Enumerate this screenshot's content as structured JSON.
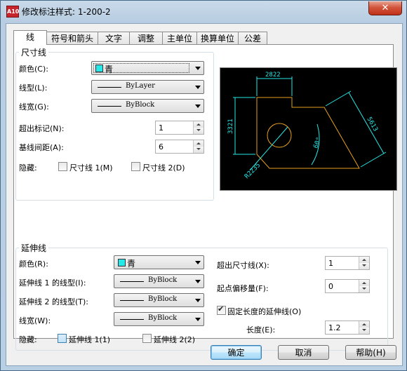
{
  "window": {
    "title": "修改标注样式: 1-200-2",
    "app_icon_text": "A10",
    "close_symbol": "✕"
  },
  "tabs": [
    "线",
    "符号和箭头",
    "文字",
    "调整",
    "主单位",
    "换算单位",
    "公差"
  ],
  "dim_line": {
    "group_title": "尺寸线",
    "color_label": "颜色(C):",
    "color_value": "青",
    "linetype_label": "线型(L):",
    "linetype_value": "ByLayer",
    "lineweight_label": "线宽(G):",
    "lineweight_value": "ByBlock",
    "extend_ticks_label": "超出标记(N):",
    "extend_ticks_value": "1",
    "baseline_spacing_label": "基线间距(A):",
    "baseline_spacing_value": "6",
    "suppress_label": "隐藏:",
    "suppress_1_label": "尺寸线 1(M)",
    "suppress_1_checked": false,
    "suppress_2_label": "尺寸线 2(D)",
    "suppress_2_checked": false
  },
  "preview": {
    "dim_top": "2822",
    "dim_left": "3321",
    "dim_right": "5613",
    "dim_radius": "R2235",
    "dim_angle": "60°",
    "colors": {
      "dimension": "#26e8e8",
      "geometry": "#e8a020",
      "background": "#000000"
    }
  },
  "ext_line": {
    "group_title": "延伸线",
    "color_label": "颜色(R):",
    "color_value": "青",
    "linetype1_label": "延伸线 1 的线型(I):",
    "linetype1_value": "ByBlock",
    "linetype2_label": "延伸线 2 的线型(T):",
    "linetype2_value": "ByBlock",
    "lineweight_label": "线宽(W):",
    "lineweight_value": "ByBlock",
    "suppress_label": "隐藏:",
    "suppress_1_label": "延伸线 1(1)",
    "suppress_1_checked": false,
    "suppress_2_label": "延伸线 2(2)",
    "suppress_2_checked": false,
    "extend_beyond_label": "超出尺寸线(X):",
    "extend_beyond_value": "1",
    "offset_label": "起点偏移量(F):",
    "offset_value": "0",
    "fixed_length_label": "固定长度的延伸线(O)",
    "fixed_length_checked": true,
    "length_label": "长度(E):",
    "length_value": "1.2"
  },
  "buttons": {
    "ok": "确定",
    "cancel": "取消",
    "help": "帮助(H)"
  }
}
